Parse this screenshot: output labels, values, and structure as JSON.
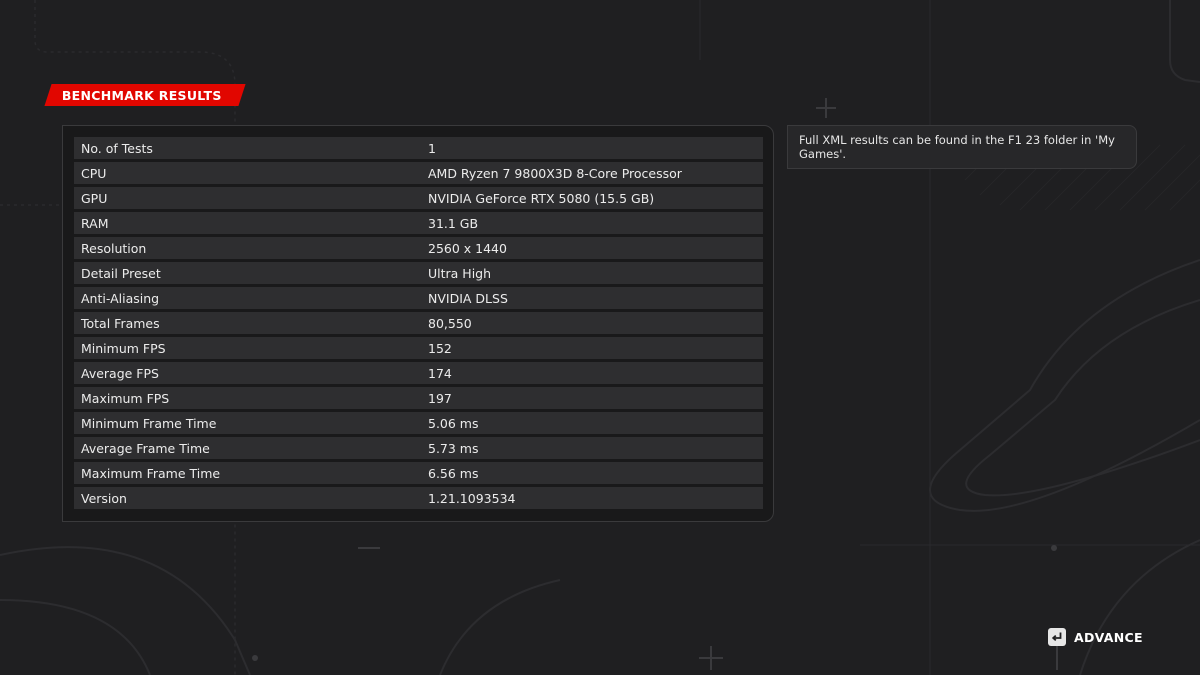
{
  "header": {
    "title": "BENCHMARK RESULTS"
  },
  "results": [
    {
      "label": "No. of Tests",
      "value": "1"
    },
    {
      "label": "CPU",
      "value": "AMD Ryzen 7 9800X3D 8-Core Processor"
    },
    {
      "label": "GPU",
      "value": "NVIDIA GeForce RTX 5080 (15.5 GB)"
    },
    {
      "label": "RAM",
      "value": "31.1 GB"
    },
    {
      "label": "Resolution",
      "value": "2560 x 1440"
    },
    {
      "label": "Detail Preset",
      "value": "Ultra High"
    },
    {
      "label": "Anti-Aliasing",
      "value": "NVIDIA DLSS"
    },
    {
      "label": "Total Frames",
      "value": "80,550"
    },
    {
      "label": "Minimum FPS",
      "value": "152"
    },
    {
      "label": "Average FPS",
      "value": "174"
    },
    {
      "label": "Maximum FPS",
      "value": "197"
    },
    {
      "label": "Minimum Frame Time",
      "value": "5.06 ms"
    },
    {
      "label": "Average Frame Time",
      "value": "5.73 ms"
    },
    {
      "label": "Maximum Frame Time",
      "value": "6.56 ms"
    },
    {
      "label": "Version",
      "value": "1.21.1093534"
    }
  ],
  "info": {
    "text": "Full XML results can be found in the F1 23 folder in 'My Games'."
  },
  "footer": {
    "advance_label": "ADVANCE",
    "advance_icon": "enter-key-icon"
  },
  "colors": {
    "background": "#1f1f21",
    "accent": "#e10600",
    "row": "#2e2e30",
    "panel": "#19191a",
    "text": "#ececec"
  }
}
